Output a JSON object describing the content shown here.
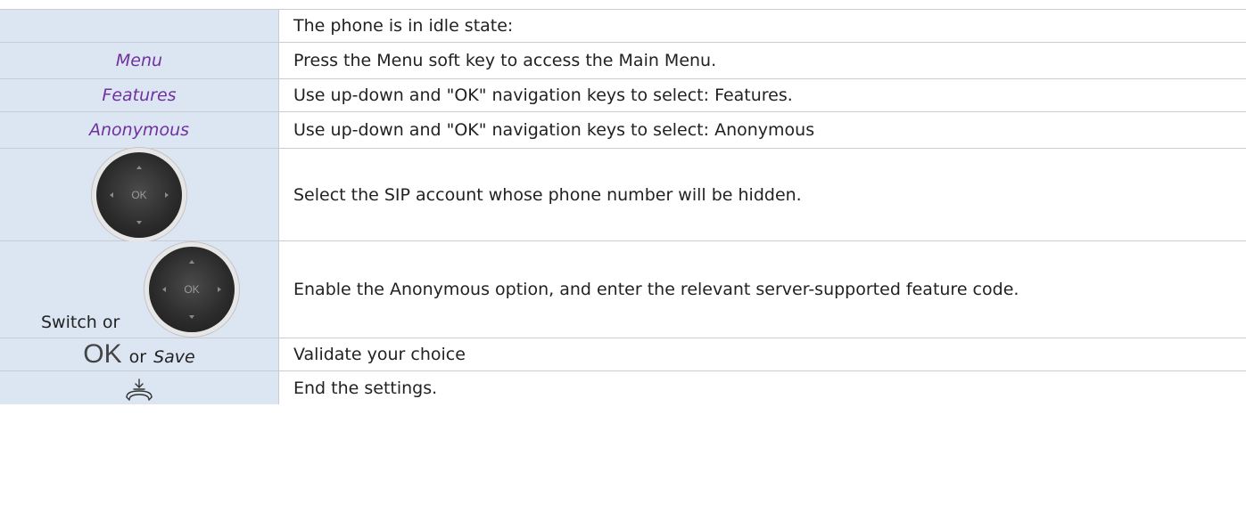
{
  "steps": [
    {
      "key": "",
      "text": "The phone is in idle state:"
    },
    {
      "key": "Menu",
      "text": "Press the Menu soft key to access the Main Menu."
    },
    {
      "key": "Features",
      "text": "Use up-down and \"OK\" navigation keys to select: Features."
    },
    {
      "key": "Anonymous",
      "text": "Use up-down and \"OK\" navigation keys to select: Anonymous"
    },
    {
      "key_icon": "navigation-pad-icon",
      "pad_label": "OK",
      "text": "Select the SIP account whose phone number will be hidden."
    },
    {
      "key_prefix": "Switch or",
      "key_icon": "navigation-pad-icon",
      "pad_label": "OK",
      "text": "Enable the Anonymous option, and enter the relevant server-supported feature code."
    },
    {
      "ok_label": "OK",
      "or_label": "or",
      "save_label": "Save",
      "text": "Validate your choice"
    },
    {
      "key_icon": "hang-up-icon",
      "text": "End the settings."
    }
  ],
  "colors": {
    "key_column_bg": "#dce6f2",
    "softkey_text": "#7030a0",
    "border": "#c9ccd1"
  }
}
